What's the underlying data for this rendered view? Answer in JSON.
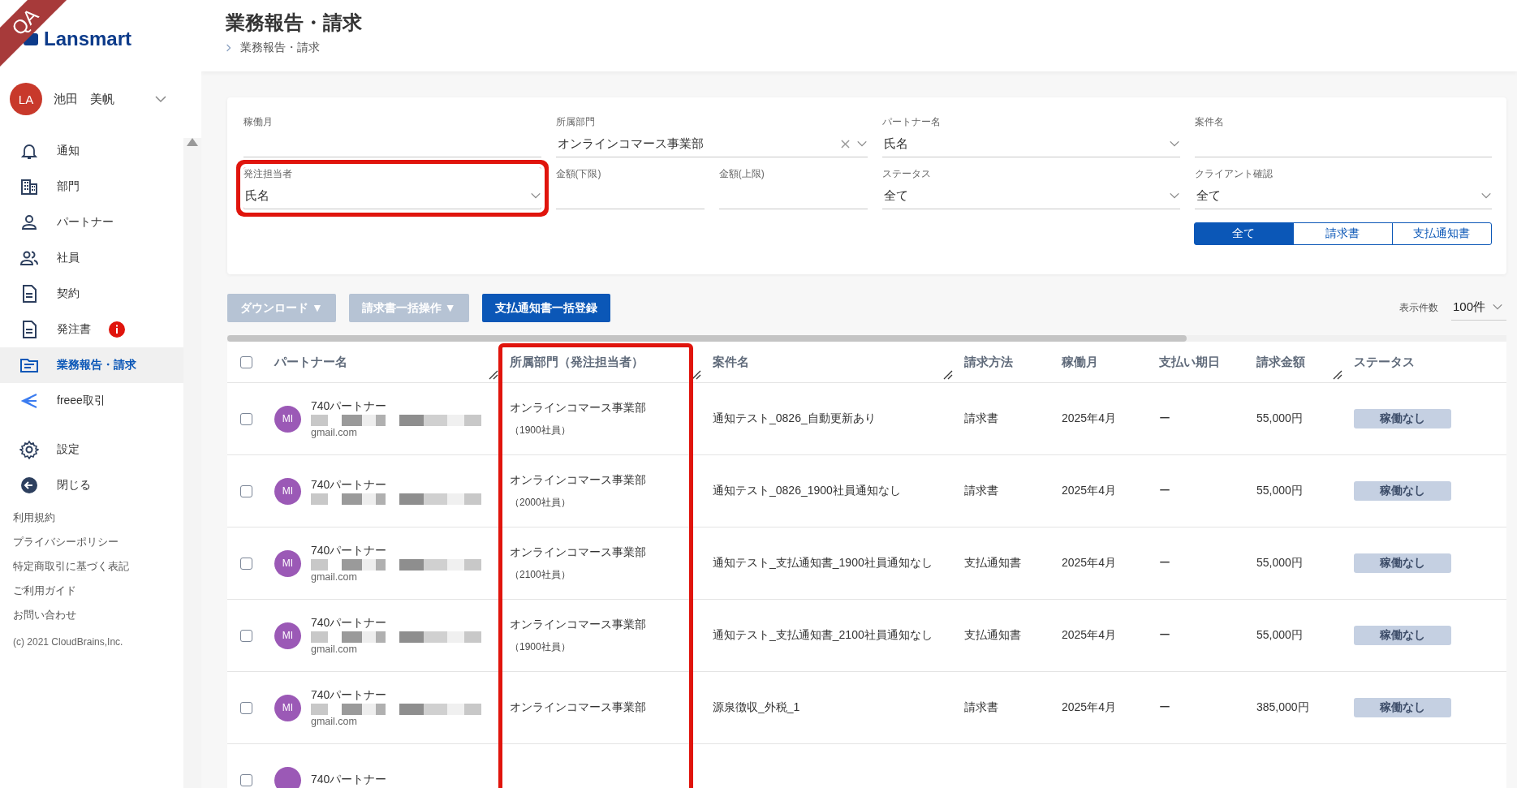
{
  "env_badge": "QA",
  "brand": {
    "name": "Lansmart"
  },
  "user": {
    "initials": "LA",
    "name": "池田　美帆"
  },
  "nav": [
    {
      "label": "通知",
      "selected": false,
      "alert": false
    },
    {
      "label": "部門",
      "selected": false,
      "alert": false
    },
    {
      "label": "パートナー",
      "selected": false,
      "alert": false
    },
    {
      "label": "社員",
      "selected": false,
      "alert": false
    },
    {
      "label": "契約",
      "selected": false,
      "alert": false
    },
    {
      "label": "発注書",
      "selected": false,
      "alert": true
    },
    {
      "label": "業務報告・請求",
      "selected": true,
      "alert": false
    },
    {
      "label": "freee取引",
      "selected": false,
      "alert": false
    },
    {
      "label": "設定",
      "selected": false,
      "alert": false
    },
    {
      "label": "閉じる",
      "selected": false,
      "alert": false
    }
  ],
  "footer_links": [
    "利用規約",
    "プライバシーポリシー",
    "特定商取引に基づく表記",
    "ご利用ガイド",
    "お問い合わせ"
  ],
  "copyright": "(c) 2021 CloudBrains,Inc.",
  "page_header": {
    "title": "業務報告・請求",
    "breadcrumb": "業務報告・請求"
  },
  "filters": {
    "fields": [
      {
        "label": "稼働月",
        "kind": "text",
        "highlighted": false
      },
      {
        "label": "所属部門",
        "kind": "select",
        "value": "オンラインコマース事業部",
        "clearable": true,
        "highlighted": false
      },
      {
        "label": "パートナー名",
        "kind": "select",
        "value": "氏名",
        "clearable": false,
        "highlighted": false
      },
      {
        "label": "案件名",
        "kind": "text",
        "highlighted": false
      },
      {
        "label": "発注担当者",
        "kind": "select",
        "value": "氏名",
        "clearable": false,
        "highlighted": true
      },
      {
        "label": "金額(下限)",
        "kind": "amount",
        "highlighted": false
      },
      {
        "label": "金額(上限)",
        "kind": "amount",
        "highlighted": false
      },
      {
        "label": "ステータス",
        "kind": "select",
        "value": "全て",
        "clearable": false,
        "highlighted": false
      },
      {
        "label": "クライアント確認",
        "kind": "select",
        "value": "全て",
        "clearable": false,
        "highlighted": false
      }
    ],
    "doc_type_tabs": [
      {
        "label": "全て",
        "selected": true
      },
      {
        "label": "請求書",
        "selected": false
      },
      {
        "label": "支払通知書",
        "selected": false
      }
    ]
  },
  "toolbar": {
    "buttons": [
      {
        "label": "ダウンロード ▼",
        "disabled": true
      },
      {
        "label": "請求書一括操作 ▼",
        "disabled": true
      },
      {
        "label": "支払通知書一括登録",
        "disabled": false
      }
    ],
    "page_size": {
      "label": "表示件数",
      "value": "100件"
    }
  },
  "table": {
    "select_all_checked": false,
    "columns": [
      {
        "label": "パートナー名",
        "resizable": true,
        "highlighted": false
      },
      {
        "label": "所属部門（発注担当者）",
        "resizable": true,
        "highlighted": true
      },
      {
        "label": "案件名",
        "resizable": true,
        "highlighted": false
      },
      {
        "label": "請求方法",
        "resizable": false,
        "highlighted": false
      },
      {
        "label": "稼働月",
        "resizable": false,
        "highlighted": false
      },
      {
        "label": "支払い期日",
        "resizable": false,
        "highlighted": false
      },
      {
        "label": "請求金額",
        "resizable": true,
        "highlighted": false
      },
      {
        "label": "ステータス",
        "resizable": false,
        "highlighted": false
      }
    ],
    "rows": [
      {
        "checked": false,
        "initials": "MI",
        "partner": "740パートナー",
        "email": "gmail.com",
        "department": "オンラインコマース事業部",
        "orderer": "（1900社員）",
        "case": "通知テスト_0826_自動更新あり",
        "method": "請求書",
        "month": "2025年4月",
        "due": "ー",
        "amount": "55,000円",
        "status": "稼働なし"
      },
      {
        "checked": false,
        "initials": "MI",
        "partner": "740パートナー",
        "department": "オンラインコマース事業部",
        "orderer": "（2000社員）",
        "case": "通知テスト_0826_1900社員通知なし",
        "method": "請求書",
        "month": "2025年4月",
        "due": "ー",
        "amount": "55,000円",
        "status": "稼働なし"
      },
      {
        "checked": false,
        "initials": "MI",
        "partner": "740パートナー",
        "email": "gmail.com",
        "department": "オンラインコマース事業部",
        "orderer": "（2100社員）",
        "case": "通知テスト_支払通知書_1900社員通知なし",
        "method": "支払通知書",
        "month": "2025年4月",
        "due": "ー",
        "amount": "55,000円",
        "status": "稼働なし"
      },
      {
        "checked": false,
        "initials": "MI",
        "partner": "740パートナー",
        "email": "gmail.com",
        "department": "オンラインコマース事業部",
        "orderer": "（1900社員）",
        "case": "通知テスト_支払通知書_2100社員通知なし",
        "method": "支払通知書",
        "month": "2025年4月",
        "due": "ー",
        "amount": "55,000円",
        "status": "稼働なし"
      },
      {
        "checked": false,
        "initials": "MI",
        "partner": "740パートナー",
        "email": "gmail.com",
        "department": "オンラインコマース事業部",
        "case": "源泉徴収_外税_1",
        "method": "請求書",
        "month": "2025年4月",
        "due": "ー",
        "amount": "385,000円",
        "status": "稼働なし"
      },
      {
        "checked": false,
        "partner": "740パートナー"
      }
    ]
  }
}
